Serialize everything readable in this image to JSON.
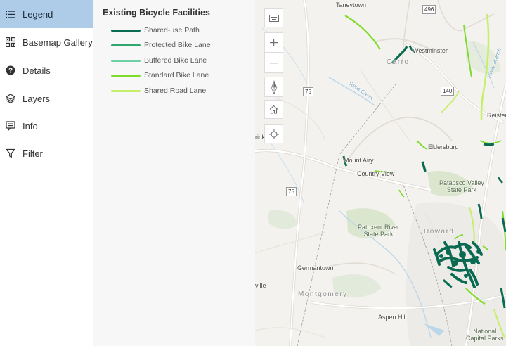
{
  "sidebar": {
    "items": [
      {
        "label": "Legend",
        "icon": "legend-icon",
        "active": true
      },
      {
        "label": "Basemap Gallery",
        "icon": "basemap-gallery-icon",
        "active": false
      },
      {
        "label": "Details",
        "icon": "details-icon",
        "active": false
      },
      {
        "label": "Layers",
        "icon": "layers-icon",
        "active": false
      },
      {
        "label": "Info",
        "icon": "info-icon",
        "active": false
      },
      {
        "label": "Filter",
        "icon": "filter-icon",
        "active": false
      }
    ]
  },
  "legend": {
    "title": "Existing Bicycle Facilities",
    "items": [
      {
        "label": "Shared-use Path",
        "color": "#0b6b52"
      },
      {
        "label": "Protected Bike Lane",
        "color": "#2ea66e"
      },
      {
        "label": "Buffered Bike Lane",
        "color": "#6ed0a5"
      },
      {
        "label": "Standard Bike Lane",
        "color": "#7edc2a"
      },
      {
        "label": "Shared Road Lane",
        "color": "#c4f06a"
      }
    ]
  },
  "map": {
    "controls": [
      {
        "name": "overview-map-button",
        "icon": "overview-map-icon"
      },
      {
        "name": "zoom-in-button",
        "icon": "plus-icon"
      },
      {
        "name": "zoom-out-button",
        "icon": "minus-icon"
      },
      {
        "name": "compass-button",
        "icon": "compass-icon"
      },
      {
        "name": "home-button",
        "icon": "home-icon"
      },
      {
        "name": "locate-button",
        "icon": "locate-icon"
      }
    ],
    "places": {
      "taneytown": "Taneytown",
      "westminster": "Westminster",
      "carroll": "Carroll",
      "mount_airy": "Mount Airy",
      "country_view": "Country View",
      "eldersburg": "Eldersburg",
      "patapsco": "Patapsco Valley\nState Park",
      "reister": "Reister",
      "patuxent": "Patuxent River\nState Park",
      "howard": "Howard",
      "germantown": "Germantown",
      "montgomery": "Montgomery",
      "aspen_hill": "Aspen Hill",
      "national_parks": "National\nCapital Parks",
      "rick": "rick",
      "ville": "ville",
      "piney_branch": "Piney Branch",
      "sams_creek": "Sams Creek"
    },
    "shields": {
      "r496": "496",
      "r75a": "75",
      "r140": "140",
      "r75b": "75"
    },
    "colors": {
      "land": "#f4f2ee",
      "park": "#dbe6cf",
      "water": "#bcd7ea",
      "road_major": "#ffffff",
      "road_border": "#d9d4cc"
    }
  }
}
